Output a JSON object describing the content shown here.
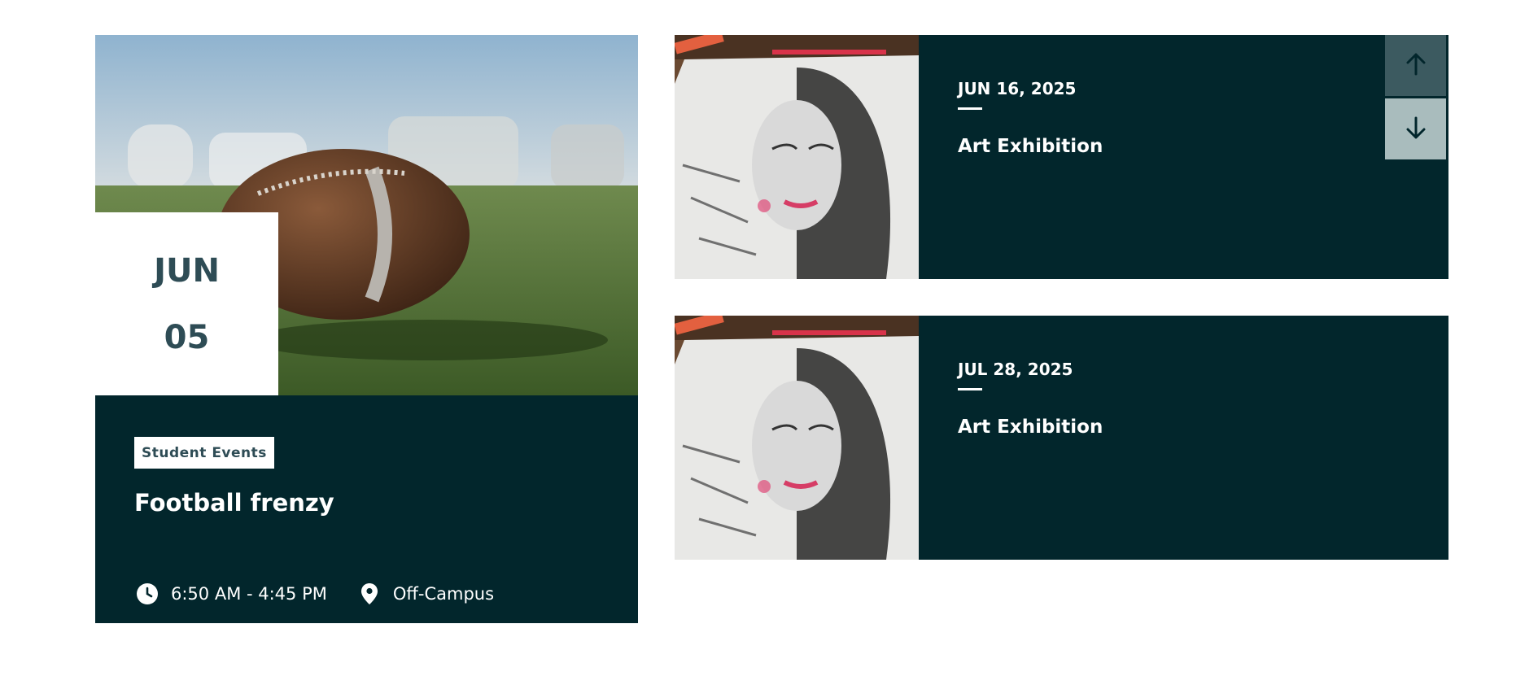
{
  "featured": {
    "month": "JUN",
    "day": "05",
    "category": "Student Events",
    "title": "Football frenzy",
    "time": "6:50 AM - 4:45 PM",
    "location": "Off-Campus",
    "image_icon": "american-football-photo"
  },
  "events": [
    {
      "date": "JUN 16, 2025",
      "title": "Art Exhibition",
      "image_icon": "sketch-portrait-photo"
    },
    {
      "date": "JUL 28, 2025",
      "title": "Art Exhibition",
      "image_icon": "sketch-portrait-photo"
    }
  ],
  "controls": {
    "prev_icon": "arrow-up-icon",
    "next_icon": "arrow-down-icon"
  },
  "colors": {
    "card_bg": "#02262c",
    "accent_text": "#2e4c55",
    "arrow_active": "#3c5a60",
    "arrow_inactive": "#a9bcbd"
  }
}
